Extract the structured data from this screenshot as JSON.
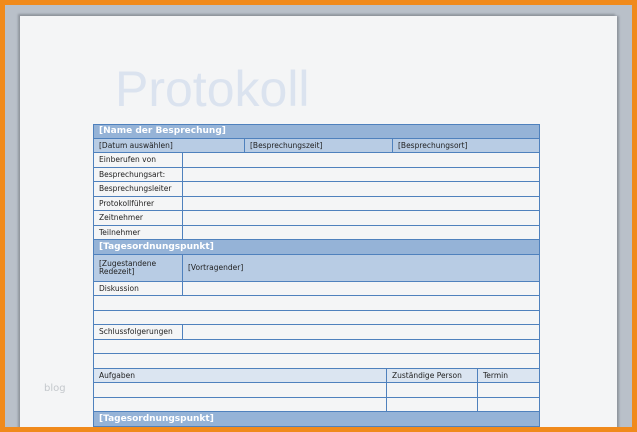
{
  "title": "Protokoll",
  "watermark": "blog",
  "meeting_name": "[Name der Besprechung]",
  "date": "[Datum auswählen]",
  "time": "[Besprechungszeit]",
  "location": "[Besprechungsort]",
  "fields": [
    "Einberufen von",
    "Besprechungsart:",
    "Besprechungsleiter",
    "Protokollführer",
    "Zeitnehmer",
    "Teilnehmer"
  ],
  "agenda": {
    "title": "[Tagesordnungspunkt]",
    "time": "[Zugestandene Redezeit]",
    "presenter": "[Vortragender]",
    "discussion": "Diskussion",
    "conclusions": "Schlussfolgerungen",
    "tasks_header": [
      "Aufgaben",
      "Zuständige Person",
      "Termin"
    ]
  },
  "agenda2": {
    "title": "[Tagesordnungspunkt]"
  }
}
